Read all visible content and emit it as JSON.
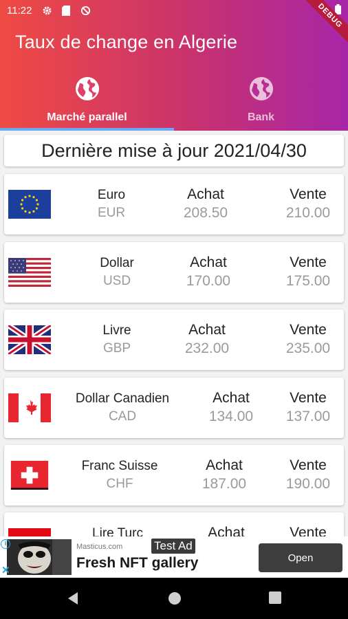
{
  "status_bar": {
    "time": "11:22"
  },
  "debug_banner": "DEBUG",
  "app": {
    "title": "Taux de change en Algerie"
  },
  "tabs": [
    {
      "label": "Marché parallel",
      "icon": "globe-icon",
      "active": true
    },
    {
      "label": "Bank",
      "icon": "globe-icon",
      "active": false
    }
  ],
  "update_text": "Dernière mise à jour 2021/04/30",
  "labels": {
    "buy": "Achat",
    "sell": "Vente"
  },
  "currencies": [
    {
      "name": "Euro",
      "code": "EUR",
      "buy": "208.50",
      "sell": "210.00",
      "flag": "eu-flag-icon"
    },
    {
      "name": "Dollar",
      "code": "USD",
      "buy": "170.00",
      "sell": "175.00",
      "flag": "us-flag-icon"
    },
    {
      "name": "Livre",
      "code": "GBP",
      "buy": "232.00",
      "sell": "235.00",
      "flag": "uk-flag-icon"
    },
    {
      "name": "Dollar Canadien",
      "code": "CAD",
      "buy": "134.00",
      "sell": "137.00",
      "flag": "canada-flag-icon"
    },
    {
      "name": "Franc Suisse",
      "code": "CHF",
      "buy": "187.00",
      "sell": "190.00",
      "flag": "swiss-flag-icon"
    },
    {
      "name": "Lire Turc",
      "code": "",
      "buy": "",
      "sell": "",
      "flag": "turkey-flag-icon"
    }
  ],
  "ad": {
    "source": "Masticus.com",
    "badge": "Test Ad",
    "title": "Fresh NFT gallery",
    "cta": "Open"
  },
  "colors": {
    "header_start": "#ef4a43",
    "header_end": "#a826a8",
    "tab_indicator": "#6aa9f5"
  }
}
